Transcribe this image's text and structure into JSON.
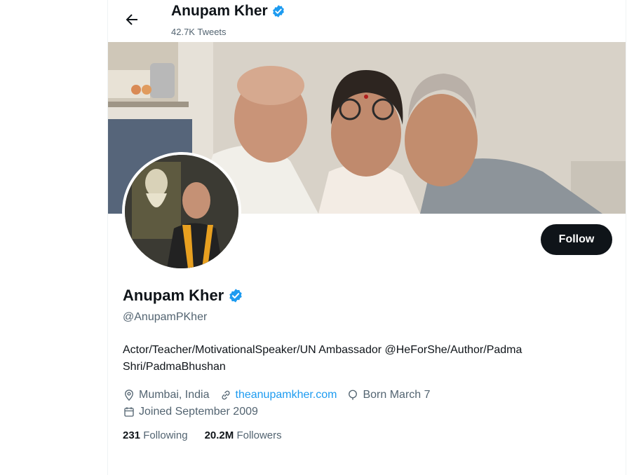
{
  "header": {
    "name": "Anupam Kher",
    "tweets_count": "42.7K Tweets"
  },
  "profile": {
    "name": "Anupam Kher",
    "handle": "@AnupamPKher",
    "bio_line1": "Actor/Teacher/MotivationalSpeaker/UN Ambassador @HeForShe/Author/Padma",
    "bio_line2": "Shri/PadmaBhushan",
    "location": "Mumbai, India",
    "website": "theanupamkher.com",
    "birthday": "Born March 7",
    "joined": "Joined September 2009"
  },
  "stats": {
    "following_count": "231",
    "following_label": "Following",
    "followers_count": "20.2M",
    "followers_label": "Followers"
  },
  "actions": {
    "follow_label": "Follow"
  },
  "colors": {
    "accent": "#1d9bf0",
    "text": "#0f1419",
    "secondary": "#536471",
    "button_bg": "#0f1419"
  },
  "icons": [
    "back-arrow-icon",
    "verified-badge-icon",
    "location-icon",
    "link-icon",
    "birthday-icon",
    "calendar-icon"
  ]
}
